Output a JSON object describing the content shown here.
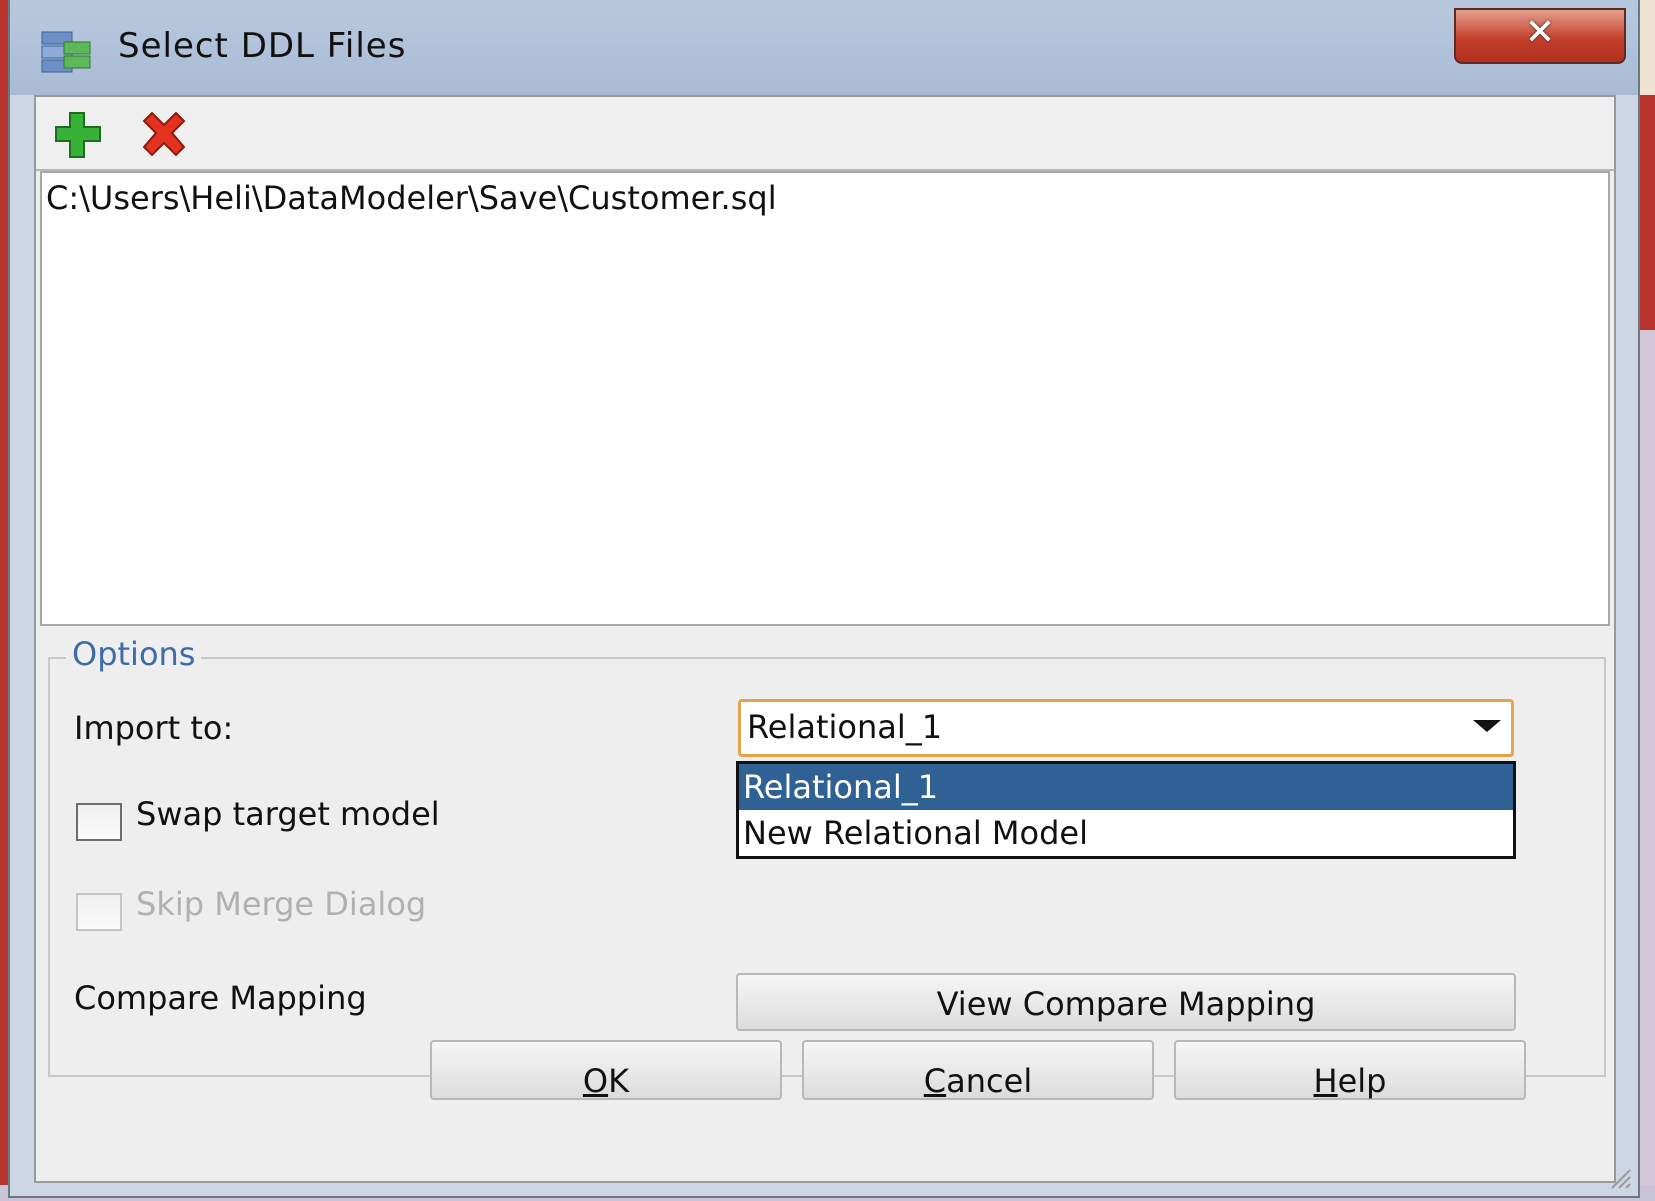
{
  "window": {
    "title": "Select DDL Files",
    "close_label": "✕"
  },
  "toolbar": {
    "add_icon": "green-plus-icon",
    "delete_icon": "red-x-icon"
  },
  "file_list": {
    "items": [
      "C:\\Users\\Heli\\DataModeler\\Save\\Customer.sql"
    ]
  },
  "options": {
    "legend": "Options",
    "import_to_label": "Import to:",
    "import_to_value": "Relational_1",
    "dropdown_options": [
      "Relational_1",
      "New Relational Model"
    ],
    "swap_label": "Swap target model",
    "swap_checked": false,
    "skip_label": "Skip Merge Dialog",
    "skip_checked": false,
    "skip_enabled": false,
    "compare_label": "Compare Mapping",
    "view_compare_button": "View Compare Mapping"
  },
  "buttons": {
    "ok_mnemonic": "O",
    "ok_rest": "K",
    "cancel_mnemonic": "C",
    "cancel_rest": "ancel",
    "help_mnemonic": "H",
    "help_rest": "elp"
  },
  "colors": {
    "selection": "#2f6194",
    "legend": "#3e6ca8",
    "combo_focus": "#e5a44a"
  }
}
